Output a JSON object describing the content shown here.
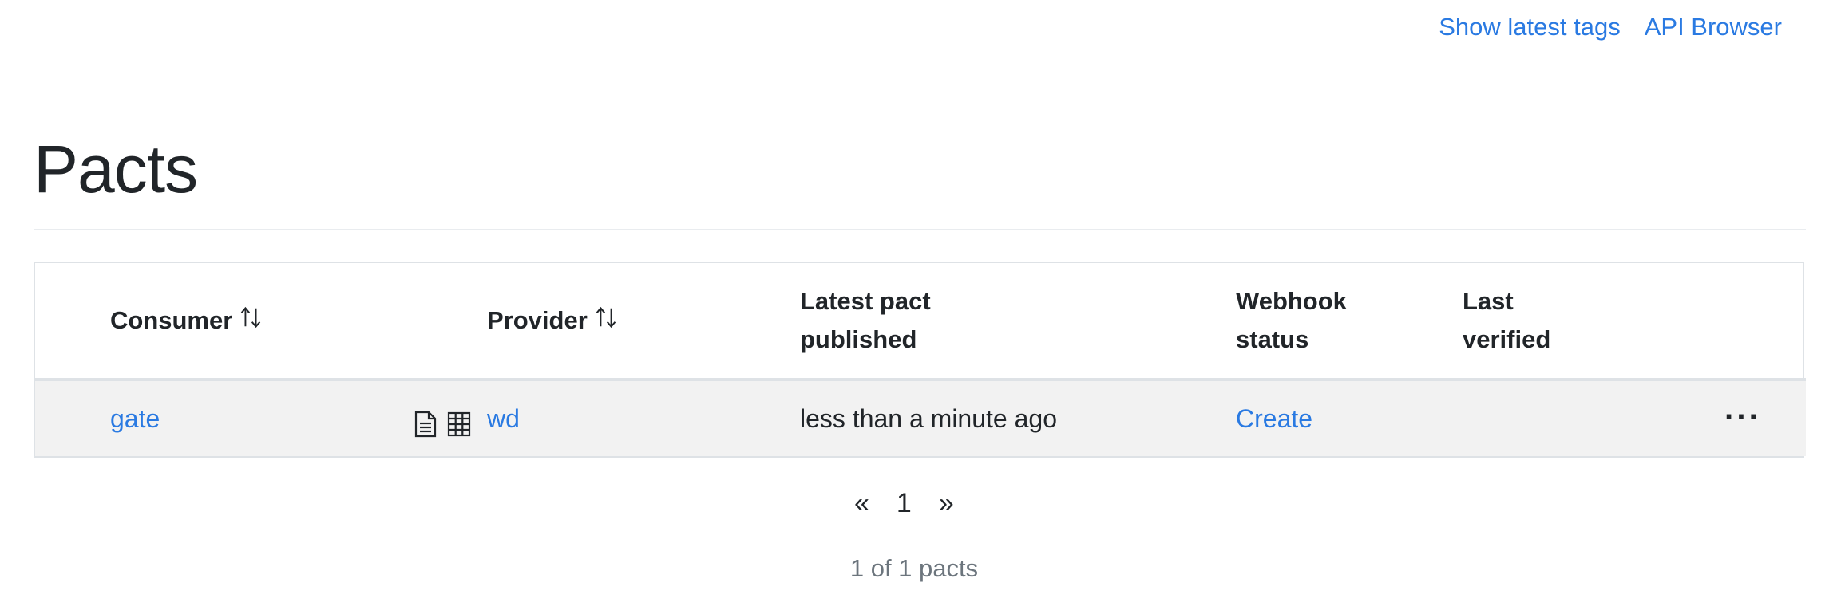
{
  "nav": {
    "show_latest_tags": "Show latest tags",
    "api_browser": "API Browser"
  },
  "page_title": "Pacts",
  "table": {
    "headers": {
      "consumer": "Consumer",
      "provider": "Provider",
      "latest_pact_published_line1": "Latest pact",
      "latest_pact_published_line2": "published",
      "webhook_status_line1": "Webhook",
      "webhook_status_line2": "status",
      "last_verified_line1": "Last",
      "last_verified_line2": "verified"
    },
    "rows": [
      {
        "consumer": "gate",
        "provider": "wd",
        "latest_pact_published": "less than a minute ago",
        "webhook_status": "Create",
        "last_verified": "",
        "actions": "···"
      }
    ]
  },
  "pagination": {
    "prev": "«",
    "current_page": "1",
    "next": "»"
  },
  "summary": "1 of 1 pacts",
  "colors": {
    "link": "#2a7ae2",
    "row_bg": "#f2f2f2",
    "border": "#dee2e6",
    "muted_text": "#6c757d"
  },
  "icons": {
    "sort": "sort-arrows-icon",
    "document": "document-icon",
    "matrix": "table-grid-icon"
  }
}
